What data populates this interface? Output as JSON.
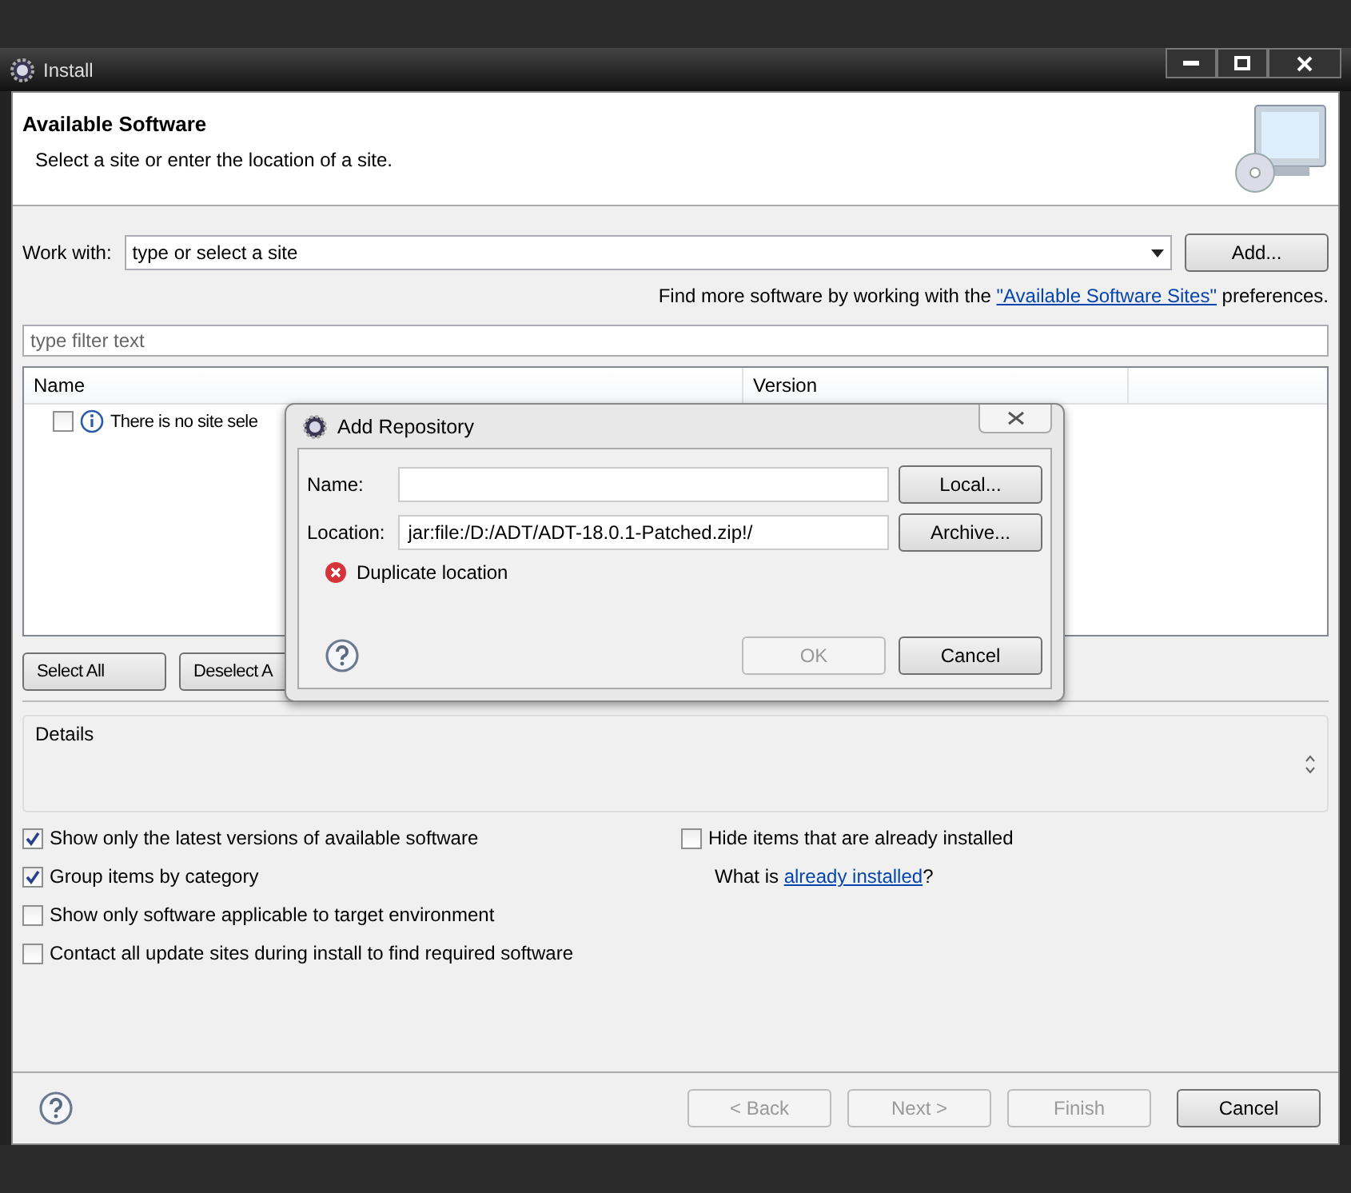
{
  "window": {
    "title": "Install"
  },
  "header": {
    "title": "Available Software",
    "subtitle": "Select a site or enter the location of a site."
  },
  "work_with": {
    "label": "Work with:",
    "value": "type or select a site",
    "button": "Add..."
  },
  "hint": {
    "before": "Find more software by working with the ",
    "link": "\"Available Software Sites\"",
    "after": " preferences."
  },
  "filter": {
    "placeholder": "type filter text"
  },
  "table": {
    "columns": [
      "Name",
      "Version"
    ],
    "rows": [
      {
        "text": "There is no site sele",
        "checked": false
      }
    ]
  },
  "table_buttons": [
    "Select All",
    "Deselect A"
  ],
  "details": {
    "label": "Details"
  },
  "options_left": [
    {
      "label": "Show only the latest versions of available software",
      "checked": true
    },
    {
      "label": "Group items by category",
      "checked": true
    },
    {
      "label": "Show only software applicable to target environment",
      "checked": false
    },
    {
      "label": "Contact all update sites during install to find required software",
      "checked": false
    }
  ],
  "options_right": [
    {
      "label": "Hide items that are already installed",
      "checked": false
    }
  ],
  "installed_note": {
    "before": "What is ",
    "link": "already installed",
    "after": "?"
  },
  "footer_buttons": [
    {
      "label": "< Back",
      "disabled": true
    },
    {
      "label": "Next >",
      "disabled": true
    },
    {
      "label": "Finish",
      "disabled": true
    },
    {
      "label": "Cancel",
      "disabled": false
    }
  ],
  "dialog": {
    "title": "Add Repository",
    "fields": [
      {
        "label": "Name:",
        "button": "Local..."
      },
      {
        "label": "Location:",
        "value": "jar:file:/D:/ADT/ADT-18.0.1-Patched.zip!/",
        "button": "Archive..."
      }
    ],
    "error": "Duplicate location",
    "buttons": [
      {
        "label": "OK",
        "disabled": true
      },
      {
        "label": "Cancel",
        "disabled": false
      }
    ]
  }
}
